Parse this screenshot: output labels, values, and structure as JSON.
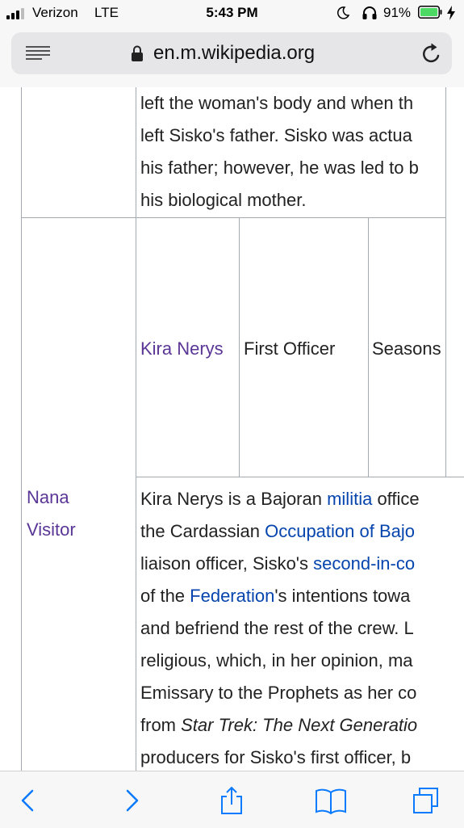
{
  "status_bar": {
    "carrier": "Verizon",
    "network": "LTE",
    "time": "5:43 PM",
    "battery_percent": "91%",
    "icons": [
      "signal-icon",
      "moon-icon",
      "headphones-icon",
      "battery-icon",
      "charging-bolt-icon"
    ]
  },
  "address_bar": {
    "url": "en.m.wikipedia.org",
    "icons": [
      "reader-view-icon",
      "lock-icon",
      "reload-icon"
    ]
  },
  "table": {
    "prev_row_description_lines": [
      "left the woman's body and when th",
      "left Sisko's father. Sisko was actua",
      "his father; however, he was led to b",
      "his biological mother."
    ],
    "actor": [
      "Nana",
      "Visitor"
    ],
    "character": "Kira Nerys",
    "rank": "First Officer",
    "seasons": "Seasons",
    "description_lines": [
      [
        {
          "t": "Kira Nerys is a Bajoran "
        },
        {
          "t": "militia",
          "link": true
        },
        {
          "t": " office"
        }
      ],
      [
        {
          "t": "the Cardassian "
        },
        {
          "t": "Occupation of Bajo",
          "link": true
        }
      ],
      [
        {
          "t": "liaison officer, Sisko's "
        },
        {
          "t": "second-in-co",
          "link": true
        }
      ],
      [
        {
          "t": "of the "
        },
        {
          "t": "Federation",
          "link": true
        },
        {
          "t": "'s intentions towa"
        }
      ],
      [
        {
          "t": "and befriend the rest of the crew. L"
        }
      ],
      [
        {
          "t": "religious, which, in her opinion, ma"
        }
      ],
      [
        {
          "t": "Emissary to the Prophets as her co"
        }
      ],
      [
        {
          "t": "from "
        },
        {
          "t": "Star Trek: The Next Generatio",
          "italic": true
        }
      ],
      [
        {
          "t": "producers for Sisko's first officer, b"
        }
      ]
    ]
  },
  "toolbar": {
    "icons": [
      "back-icon",
      "forward-icon",
      "share-icon",
      "bookmarks-icon",
      "tabs-icon"
    ]
  },
  "colors": {
    "link": "#0645ad",
    "visited_link": "#5a3696",
    "border": "#a2a9b1",
    "ios_blue": "#0a7aff"
  }
}
